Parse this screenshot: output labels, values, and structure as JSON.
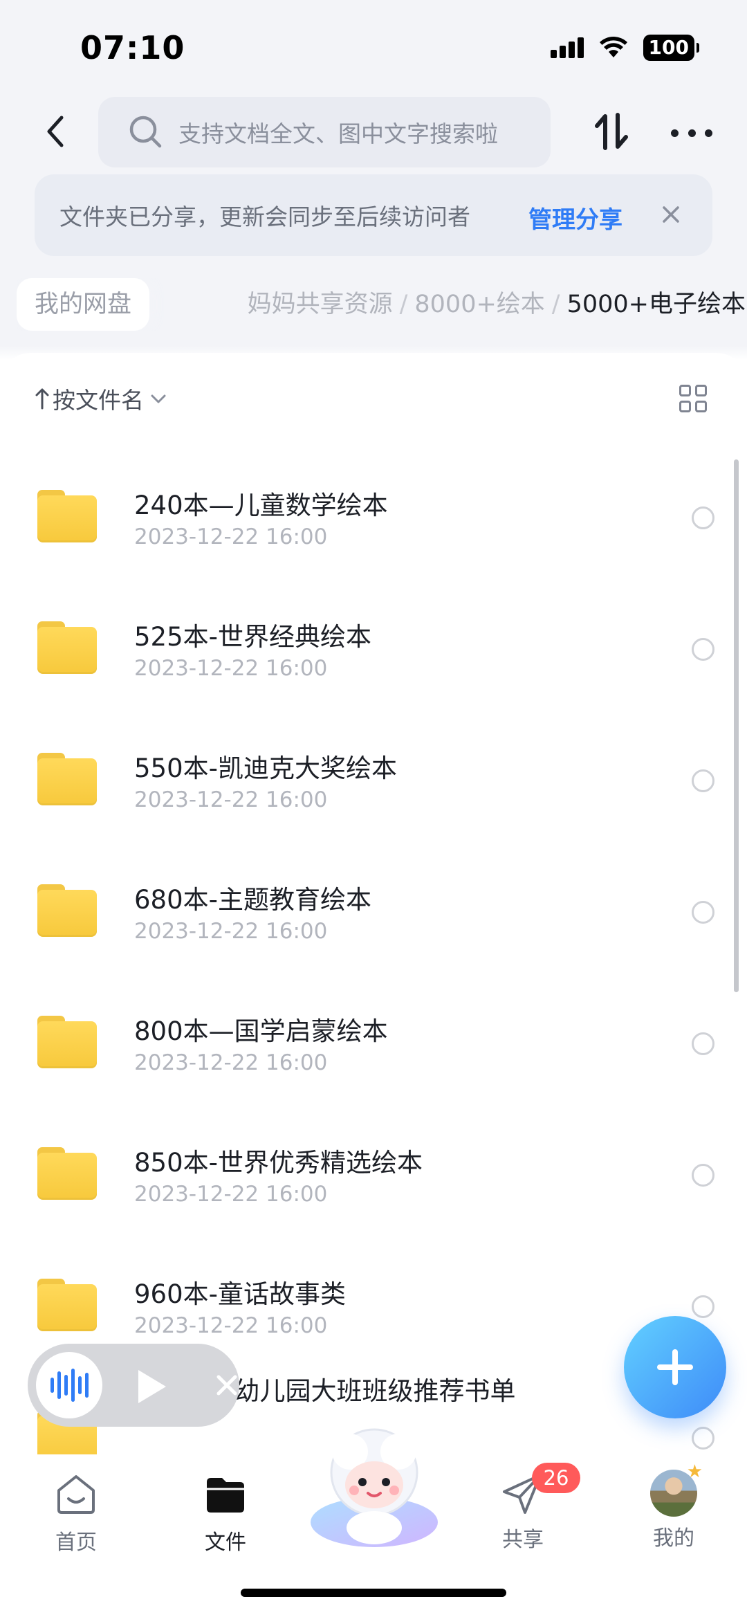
{
  "status_bar": {
    "time": "07:10",
    "battery": "100"
  },
  "search": {
    "placeholder": "支持文档全文、图中文字搜索啦"
  },
  "share_banner": {
    "message": "文件夹已分享，更新会同步至后续访问者",
    "manage_label": "管理分享"
  },
  "breadcrumb": {
    "root": "我的网盘",
    "items": [
      "妈妈共享资源",
      "8000+绘本"
    ],
    "separator": "/",
    "current": "5000+电子绘本"
  },
  "toolbar": {
    "sort_label": "按文件名"
  },
  "files": [
    {
      "name": "240本—儿童数学绘本",
      "date": "2023-12-22 16:00"
    },
    {
      "name": "525本-世界经典绘本",
      "date": "2023-12-22 16:00"
    },
    {
      "name": "550本-凯迪克大奖绘本",
      "date": "2023-12-22 16:00"
    },
    {
      "name": "680本-主题教育绘本",
      "date": "2023-12-22 16:00"
    },
    {
      "name": "800本—国学启蒙绘本",
      "date": "2023-12-22 16:00"
    },
    {
      "name": "850本-世界优秀精选绘本",
      "date": "2023-12-22 16:00"
    },
    {
      "name": "960本-童话故事类",
      "date": "2023-12-22 16:00"
    },
    {
      "name": "1200本-幼儿园大班班级推荐书单",
      "date": ""
    }
  ],
  "tab_bar": {
    "home": "首页",
    "files": "文件",
    "share": "共享",
    "share_badge": "26",
    "me": "我的"
  },
  "colors": {
    "accent": "#2f7cf6",
    "folder": "#f7c93c",
    "badge": "#ff5a5a"
  }
}
